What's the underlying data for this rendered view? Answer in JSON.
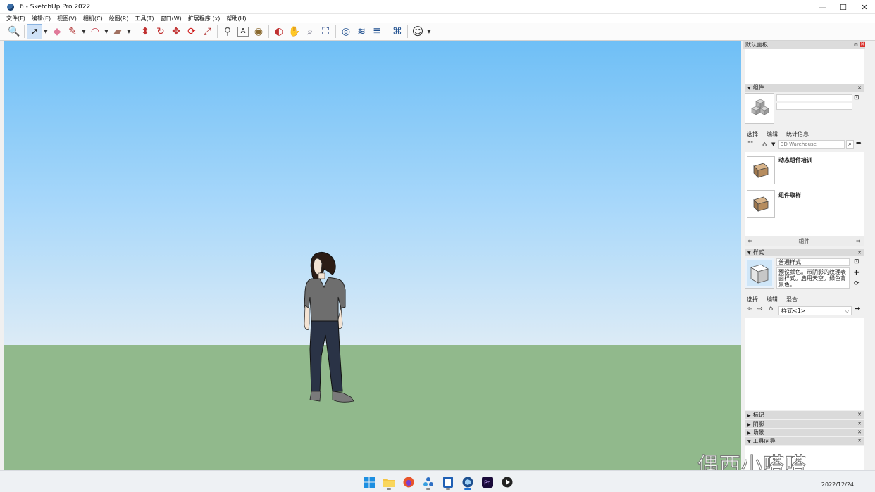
{
  "window": {
    "title": "6 - SketchUp Pro 2022",
    "controls": {
      "minimize": "—",
      "maximize": "☐",
      "close": "✕"
    }
  },
  "menu": {
    "items": [
      "文件(F)",
      "编辑(E)",
      "视图(V)",
      "相机(C)",
      "绘图(R)",
      "工具(T)",
      "窗口(W)",
      "扩展程序 (x)",
      "帮助(H)"
    ]
  },
  "toolbar": {
    "tools": [
      {
        "name": "zoom-extents-icon",
        "glyph": "🔍"
      },
      {
        "name": "select-icon",
        "glyph": "➚",
        "active": true
      },
      {
        "name": "eraser-icon",
        "glyph": "◆"
      },
      {
        "name": "pencil-icon",
        "glyph": "✎"
      },
      {
        "name": "arc-icon",
        "glyph": "◠"
      },
      {
        "name": "rectangle-icon",
        "glyph": "▰"
      },
      {
        "name": "push-pull-icon",
        "glyph": "⬍"
      },
      {
        "name": "follow-me-icon",
        "glyph": "↻"
      },
      {
        "name": "move-icon",
        "glyph": "✥"
      },
      {
        "name": "rotate-icon",
        "glyph": "⟳"
      },
      {
        "name": "scale-icon",
        "glyph": "⤢"
      },
      {
        "name": "tape-measure-icon",
        "glyph": "⚲"
      },
      {
        "name": "text-icon",
        "glyph": "A"
      },
      {
        "name": "paint-bucket-icon",
        "glyph": "◉"
      },
      {
        "name": "orbit-icon",
        "glyph": "◐"
      },
      {
        "name": "pan-icon",
        "glyph": "✋"
      },
      {
        "name": "zoom-icon",
        "glyph": "⌕"
      },
      {
        "name": "zoom-window-icon",
        "glyph": "⛶"
      },
      {
        "name": "warehouse-icon",
        "glyph": "◎"
      },
      {
        "name": "extension-warehouse-icon",
        "glyph": "≋"
      },
      {
        "name": "layers-icon",
        "glyph": "≣"
      },
      {
        "name": "sandbox-icon",
        "glyph": "⌘"
      },
      {
        "name": "account-icon",
        "glyph": "☺"
      }
    ]
  },
  "panel": {
    "title": "默认面板",
    "components": {
      "header": "组件",
      "tabs": [
        "选择",
        "编辑",
        "统计信息"
      ],
      "search_placeholder": "3D Warehouse",
      "items": [
        "动态组件培训",
        "组件取样"
      ],
      "footer": "组件"
    },
    "styles": {
      "header": "样式",
      "style_name": "普通样式",
      "description": "预设颜色。带阴影的纹理表面样式。启用天空。绿色背景色。",
      "tabs": [
        "选择",
        "编辑",
        "混合"
      ],
      "dropdown": "样式<1>"
    },
    "collapsed": [
      "标记",
      "阴影",
      "场景",
      "工具向导"
    ]
  },
  "taskbar": {
    "icons": [
      "windows-start-icon",
      "file-explorer-icon",
      "firefox-icon",
      "network-app-icon",
      "notebook-app-icon",
      "sketchup-icon",
      "premiere-icon",
      "media-player-icon"
    ],
    "date": "2022/12/24"
  },
  "watermark": "偶西小嗒嗒",
  "colors": {
    "sky_top": "#6fbff6",
    "ground": "#91b98c",
    "close_red": "#d9322d"
  }
}
